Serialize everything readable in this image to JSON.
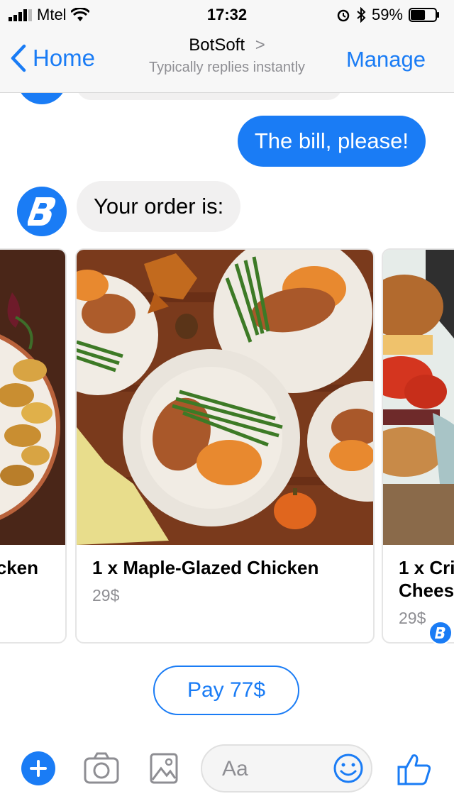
{
  "status_bar": {
    "carrier": "Mtel",
    "time": "17:32",
    "battery_percent": "59%",
    "battery_level": 0.59
  },
  "nav": {
    "back_label": "Home",
    "title": "BotSoft",
    "title_chevron": ">",
    "subtitle": "Typically replies instantly",
    "manage_label": "Manage"
  },
  "messages": {
    "outgoing": "The bill, please!",
    "incoming": "Your order is:"
  },
  "cards": [
    {
      "title": "cken",
      "price": ""
    },
    {
      "title": "1 x Maple-Glazed Chicken",
      "price": "29$"
    },
    {
      "title_line1": "1 x Cri",
      "title_line2": "Chees",
      "price": "29$"
    }
  ],
  "pay_button": "Pay 77$",
  "composer": {
    "placeholder": "Aa"
  },
  "colors": {
    "accent": "#1a7cf5",
    "bubble_incoming": "#f1f0f0",
    "secondary_text": "#8e8e93"
  }
}
